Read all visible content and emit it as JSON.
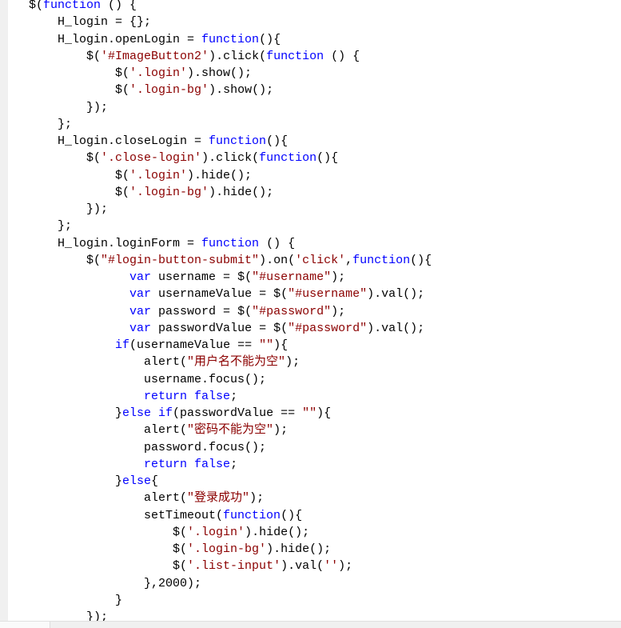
{
  "colors": {
    "keyword": "#0000ff",
    "string": "#8b0000",
    "text": "#000000"
  },
  "code_lines": [
    [
      [
        "p",
        "    $("
      ],
      [
        "k",
        "function"
      ],
      [
        "p",
        " () {"
      ]
    ],
    [
      [
        "p",
        "        H_login = {};"
      ]
    ],
    [
      [
        "p",
        "        H_login.openLogin = "
      ],
      [
        "k",
        "function"
      ],
      [
        "p",
        "(){"
      ]
    ],
    [
      [
        "p",
        "            $("
      ],
      [
        "s",
        "'#ImageButton2'"
      ],
      [
        "p",
        ").click("
      ],
      [
        "k",
        "function"
      ],
      [
        "p",
        " () {"
      ]
    ],
    [
      [
        "p",
        "                $("
      ],
      [
        "s",
        "'.login'"
      ],
      [
        "p",
        ").show();"
      ]
    ],
    [
      [
        "p",
        "                $("
      ],
      [
        "s",
        "'.login-bg'"
      ],
      [
        "p",
        ").show();"
      ]
    ],
    [
      [
        "p",
        "            });"
      ]
    ],
    [
      [
        "p",
        "        };"
      ]
    ],
    [
      [
        "p",
        "        H_login.closeLogin = "
      ],
      [
        "k",
        "function"
      ],
      [
        "p",
        "(){"
      ]
    ],
    [
      [
        "p",
        "            $("
      ],
      [
        "s",
        "'.close-login'"
      ],
      [
        "p",
        ").click("
      ],
      [
        "k",
        "function"
      ],
      [
        "p",
        "(){"
      ]
    ],
    [
      [
        "p",
        "                $("
      ],
      [
        "s",
        "'.login'"
      ],
      [
        "p",
        ").hide();"
      ]
    ],
    [
      [
        "p",
        "                $("
      ],
      [
        "s",
        "'.login-bg'"
      ],
      [
        "p",
        ").hide();"
      ]
    ],
    [
      [
        "p",
        "            });"
      ]
    ],
    [
      [
        "p",
        "        };"
      ]
    ],
    [
      [
        "p",
        "        H_login.loginForm = "
      ],
      [
        "k",
        "function"
      ],
      [
        "p",
        " () {"
      ]
    ],
    [
      [
        "p",
        "            $("
      ],
      [
        "s",
        "\"#login-button-submit\""
      ],
      [
        "p",
        ").on("
      ],
      [
        "s",
        "'click'"
      ],
      [
        "p",
        ","
      ],
      [
        "k",
        "function"
      ],
      [
        "p",
        "(){"
      ]
    ],
    [
      [
        "p",
        "                  "
      ],
      [
        "k",
        "var"
      ],
      [
        "p",
        " username = $("
      ],
      [
        "s",
        "\"#username\""
      ],
      [
        "p",
        ");"
      ]
    ],
    [
      [
        "p",
        "                  "
      ],
      [
        "k",
        "var"
      ],
      [
        "p",
        " usernameValue = $("
      ],
      [
        "s",
        "\"#username\""
      ],
      [
        "p",
        ").val();"
      ]
    ],
    [
      [
        "p",
        "                  "
      ],
      [
        "k",
        "var"
      ],
      [
        "p",
        " password = $("
      ],
      [
        "s",
        "\"#password\""
      ],
      [
        "p",
        ");"
      ]
    ],
    [
      [
        "p",
        "                  "
      ],
      [
        "k",
        "var"
      ],
      [
        "p",
        " passwordValue = $("
      ],
      [
        "s",
        "\"#password\""
      ],
      [
        "p",
        ").val();"
      ]
    ],
    [
      [
        "p",
        "                "
      ],
      [
        "k",
        "if"
      ],
      [
        "p",
        "(usernameValue == "
      ],
      [
        "s",
        "\"\""
      ],
      [
        "p",
        "){"
      ]
    ],
    [
      [
        "p",
        "                    alert("
      ],
      [
        "s",
        "\"用户名不能为空\""
      ],
      [
        "p",
        ");"
      ]
    ],
    [
      [
        "p",
        "                    username.focus();"
      ]
    ],
    [
      [
        "p",
        "                    "
      ],
      [
        "k",
        "return false"
      ],
      [
        "p",
        ";"
      ]
    ],
    [
      [
        "p",
        "                }"
      ],
      [
        "k",
        "else if"
      ],
      [
        "p",
        "(passwordValue == "
      ],
      [
        "s",
        "\"\""
      ],
      [
        "p",
        "){"
      ]
    ],
    [
      [
        "p",
        "                    alert("
      ],
      [
        "s",
        "\"密码不能为空\""
      ],
      [
        "p",
        ");"
      ]
    ],
    [
      [
        "p",
        "                    password.focus();"
      ]
    ],
    [
      [
        "p",
        "                    "
      ],
      [
        "k",
        "return false"
      ],
      [
        "p",
        ";"
      ]
    ],
    [
      [
        "p",
        "                }"
      ],
      [
        "k",
        "else"
      ],
      [
        "p",
        "{"
      ]
    ],
    [
      [
        "p",
        "                    alert("
      ],
      [
        "s",
        "\"登录成功\""
      ],
      [
        "p",
        ");"
      ]
    ],
    [
      [
        "p",
        "                    setTimeout("
      ],
      [
        "k",
        "function"
      ],
      [
        "p",
        "(){"
      ]
    ],
    [
      [
        "p",
        "                        $("
      ],
      [
        "s",
        "'.login'"
      ],
      [
        "p",
        ").hide();"
      ]
    ],
    [
      [
        "p",
        "                        $("
      ],
      [
        "s",
        "'.login-bg'"
      ],
      [
        "p",
        ").hide();"
      ]
    ],
    [
      [
        "p",
        "                        $("
      ],
      [
        "s",
        "'.list-input'"
      ],
      [
        "p",
        ").val("
      ],
      [
        "s",
        "''"
      ],
      [
        "p",
        ");"
      ]
    ],
    [
      [
        "p",
        "                    },2000);"
      ]
    ],
    [
      [
        "p",
        "                }"
      ]
    ],
    [
      [
        "p",
        "            });"
      ]
    ]
  ]
}
